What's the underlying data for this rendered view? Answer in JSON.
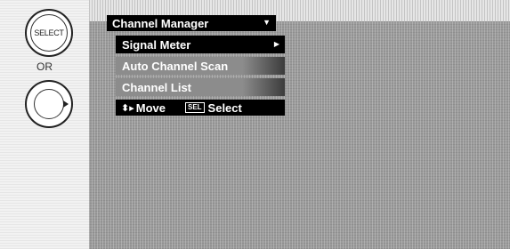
{
  "remote": {
    "select_button_label": "SELECT",
    "or_label": "OR",
    "arrow_button_icon": "right-arrow-icon"
  },
  "menu": {
    "title": "Channel Manager",
    "items": [
      {
        "label": "Signal Meter",
        "state": "selected"
      },
      {
        "label": "Auto Channel Scan",
        "state": "inactive"
      },
      {
        "label": "Channel List",
        "state": "inactive"
      }
    ],
    "footer": {
      "move_label": "Move",
      "select_badge": "SEL",
      "select_label": "Select"
    }
  }
}
